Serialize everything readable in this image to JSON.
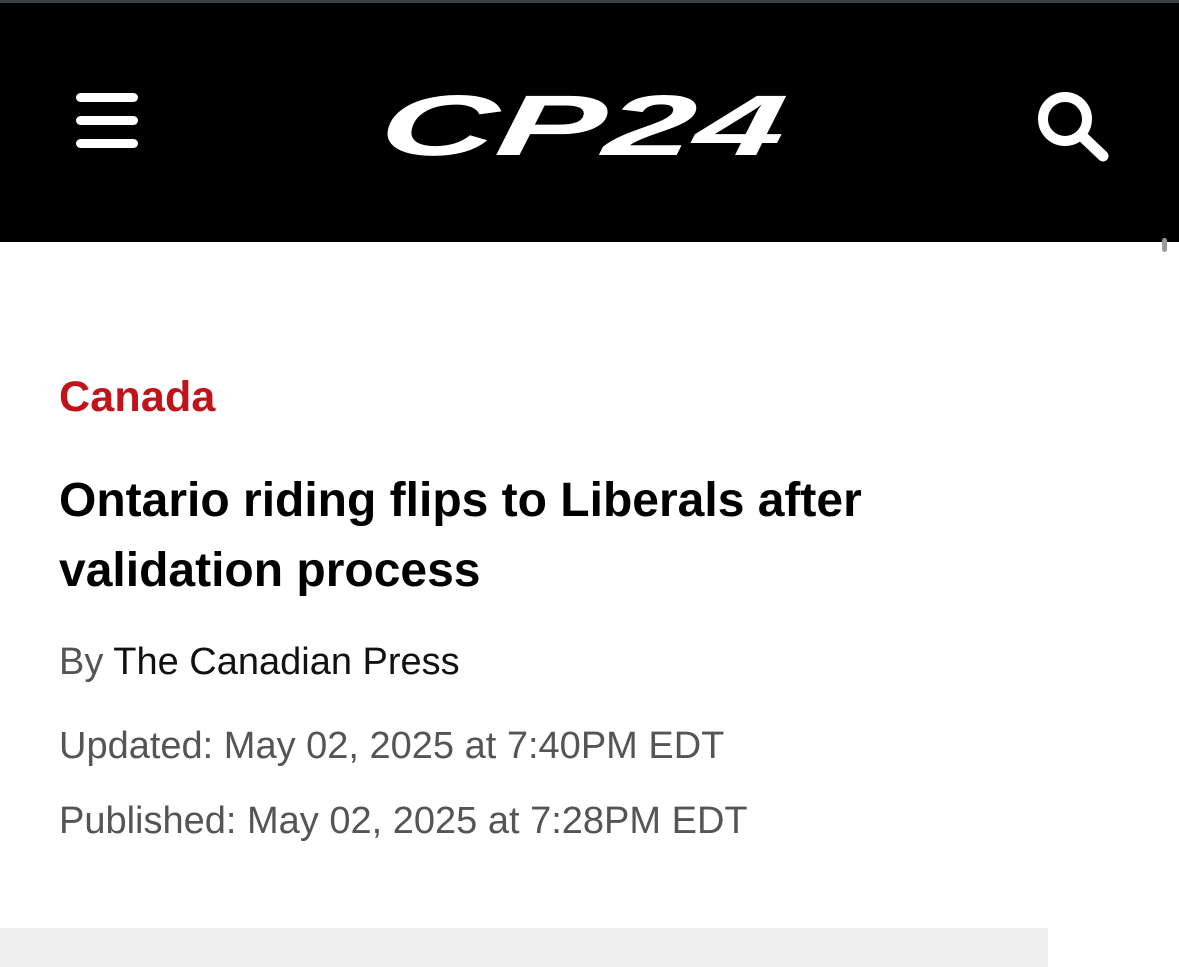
{
  "header": {
    "logo_text": "CP24",
    "menu_icon": "hamburger-menu-icon",
    "search_icon": "search-icon"
  },
  "article": {
    "category": "Canada",
    "headline": "Ontario riding flips to Liberals after validation process",
    "byline_prefix": "By",
    "byline_author": "The Canadian Press",
    "updated": "Updated: May 02, 2025 at 7:40PM EDT",
    "published": "Published: May 02, 2025 at 7:28PM EDT"
  },
  "colors": {
    "header_bg": "#000000",
    "category": "#c0131a",
    "headline": "#000000",
    "meta": "#555555"
  }
}
